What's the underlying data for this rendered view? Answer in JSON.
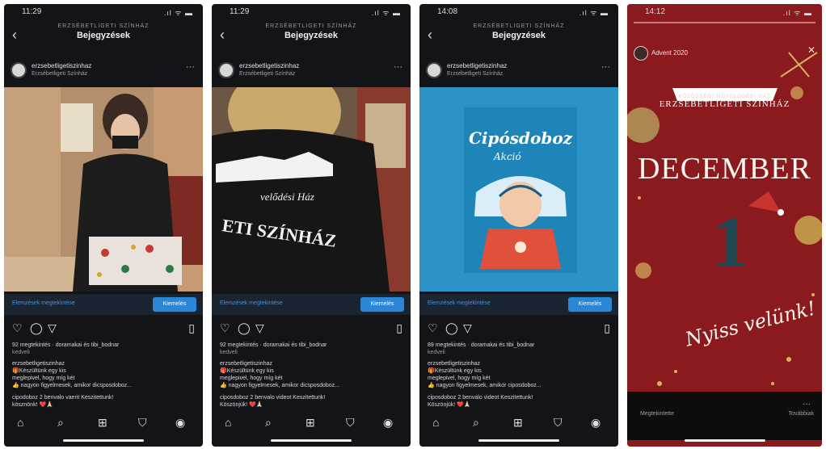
{
  "phones": [
    {
      "time": "11:29",
      "signal": ".ıl ᯤ ▬",
      "header": {
        "subtitle": "ERZSÉBETLIGETI SZÍNHÁZ",
        "title": "Bejegyzések"
      },
      "account": {
        "name": "erzsebetligetiszinhaz",
        "location": "Erzsébetligeti Színház"
      },
      "insights_label": "Elemzések megtekintése",
      "promote_label": "Kiemelés",
      "views": "92 megtekintés · doramakai és tibi_bodnar",
      "views_sub": "kedveli",
      "caption_user": "erzsebetligetiszinhaz",
      "caption_lines": [
        "🎁Készültünk egy kis",
        "meglepivel, hogy míg két",
        "👍 nagyon figyelmesek, amikor dicsposdoboz..."
      ],
      "comment": "cipodoboz 2 benvalo vaerit Keszitettunk!",
      "comment_2": "kösznönk! ❤️🙏🏻"
    },
    {
      "time": "11:29",
      "signal": ".ıl ᯤ ▬",
      "header": {
        "subtitle": "ERZSÉBETLIGETI SZÍNHÁZ",
        "title": "Bejegyzések"
      },
      "account": {
        "name": "erzsebetligetiszinhaz",
        "location": "Erzsébetligeti Színház"
      },
      "insights_label": "Elemzések megtekintése",
      "promote_label": "Kiemelés",
      "views": "92 megtekintés · doramakai és tibi_bodnar",
      "views_sub": "kedveli",
      "caption_user": "erzsebetligetiszinhaz",
      "caption_lines": [
        "🎁Készültünk egy kis",
        "meglepivel, hogy míg két",
        "👍 nagyon figyelmesek, amikor dicsposdoboz..."
      ],
      "comment": "ciposdoboz 2 benvalo videot Keszitettunk!",
      "comment_2": "Köszönjük! ❤️🙏🏻"
    },
    {
      "time": "14:08",
      "signal": ".ıl ᯤ ▬",
      "header": {
        "subtitle": "ERZSÉBETLIGETI SZÍNHÁZ",
        "title": "Bejegyzések"
      },
      "account": {
        "name": "erzsebetligetiszinhaz",
        "location": "Erzsébetligeti Színház"
      },
      "insights_label": "Elemzések megtekintése",
      "promote_label": "Kiemelés",
      "views": "89 megtekintés · doramakai és tibi_bodnar",
      "views_sub": "kedveli",
      "caption_user": "erzsebetligetiszinhaz",
      "caption_lines": [
        "🎁Készültünk egy kis",
        "meglepivel, hogy míg két",
        "👍 nagyon figyelmesek, amikor ciposdoboz..."
      ],
      "comment": "ciposdoboz 2 benvalo videot Keszitettunk!",
      "comment_2": "Köszönjük! ❤️🙏🏻"
    }
  ],
  "poster": {
    "line1": "Cipósdoboz",
    "line2": "Akció"
  },
  "photo2_text": {
    "top": "velődési Ház",
    "bottom": "ETI SZÍNHÁZ"
  },
  "story": {
    "time": "14:12",
    "signal": ".ıl ᯤ ▬",
    "user": "Advent 2020",
    "brand_small": "KÖZÖSSÉGI MŰVELŐDÉSI HÁZ",
    "brand_name": "ERZSÉBETLIGETI SZÍNHÁZ",
    "month": "DECEMBER",
    "day": "1",
    "tagline": "Nyiss velünk!",
    "viewers_label": "Megtekintette",
    "delete_label": "Továbbiak"
  },
  "colors": {
    "accent": "#2a86d6",
    "story_bg": "#8a1a1e",
    "dark_bg": "#121417",
    "poster_bg": "#2b93c6"
  },
  "icons": {
    "back": "chevron-left-icon",
    "more": "ellipsis-icon",
    "heart": "heart-icon",
    "comment": "comment-icon",
    "share": "send-icon",
    "save": "bookmark-icon",
    "home": "home-icon",
    "search": "search-icon",
    "add": "add-icon",
    "shop": "shop-icon",
    "profile": "profile-icon"
  }
}
